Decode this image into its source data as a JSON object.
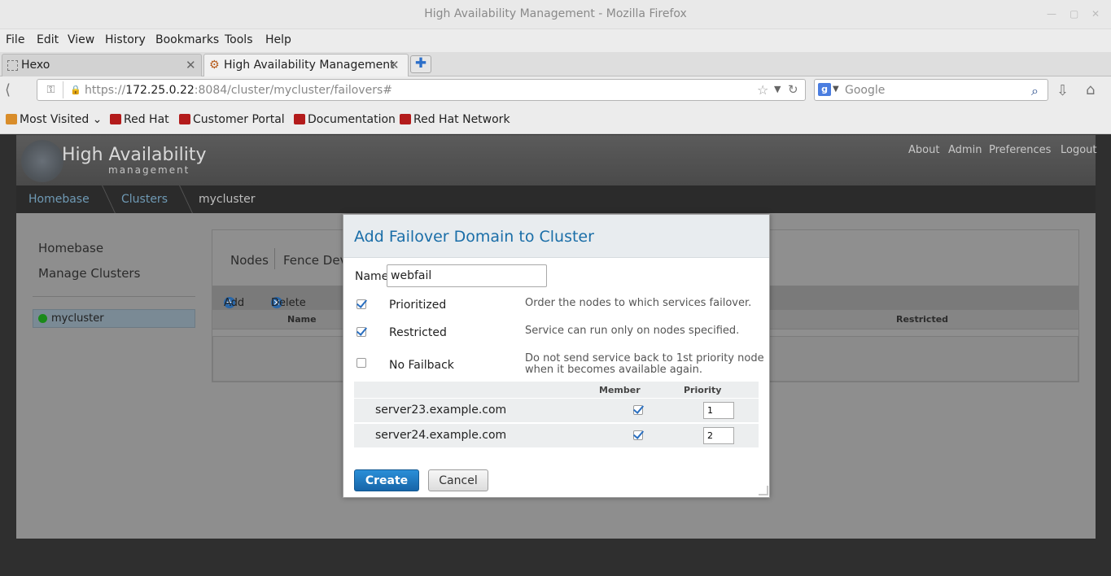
{
  "window": {
    "title": "High Availability Management - Mozilla Firefox"
  },
  "menu": [
    "File",
    "Edit",
    "View",
    "History",
    "Bookmarks",
    "Tools",
    "Help"
  ],
  "tabs": [
    {
      "label": "Hexo",
      "active": false
    },
    {
      "label": "High Availability Management",
      "active": true
    }
  ],
  "nav": {
    "url_prefix": "https://",
    "url_host": "172.25.0.22",
    "url_rest": ":8084/cluster/mycluster/failovers#",
    "search_placeholder": "Google"
  },
  "bookmarks": [
    "Most Visited",
    "Red Hat",
    "Customer Portal",
    "Documentation",
    "Red Hat Network"
  ],
  "app": {
    "logo_title": "High Availability",
    "logo_sub": "management",
    "toplinks": [
      "About",
      "Admin",
      "Preferences",
      "Logout"
    ],
    "breadcrumb": [
      "Homebase",
      "Clusters",
      "mycluster"
    ],
    "sidebar": [
      "Homebase",
      "Manage Clusters"
    ],
    "cluster_item": "mycluster",
    "panel_tabs": [
      "Nodes",
      "Fence Dev"
    ],
    "toolbar": {
      "add": "Add",
      "delete": "Delete"
    },
    "columns": {
      "name": "Name",
      "restricted": "Restricted"
    }
  },
  "dialog": {
    "title": "Add Failover Domain to Cluster",
    "name_label": "Name",
    "name_value": "webfail",
    "options": [
      {
        "label": "Prioritized",
        "desc": "Order the nodes to which services failover.",
        "checked": true
      },
      {
        "label": "Restricted",
        "desc": "Service can run only on nodes specified.",
        "checked": true
      },
      {
        "label": "No Failback",
        "desc": "Do not send service back to 1st priority node when it becomes available again.",
        "checked": false
      }
    ],
    "member_header": "Member",
    "priority_header": "Priority",
    "nodes": [
      {
        "host": "server23.example.com",
        "member": true,
        "priority": "1"
      },
      {
        "host": "server24.example.com",
        "member": true,
        "priority": "2"
      }
    ],
    "create_label": "Create",
    "cancel_label": "Cancel"
  }
}
